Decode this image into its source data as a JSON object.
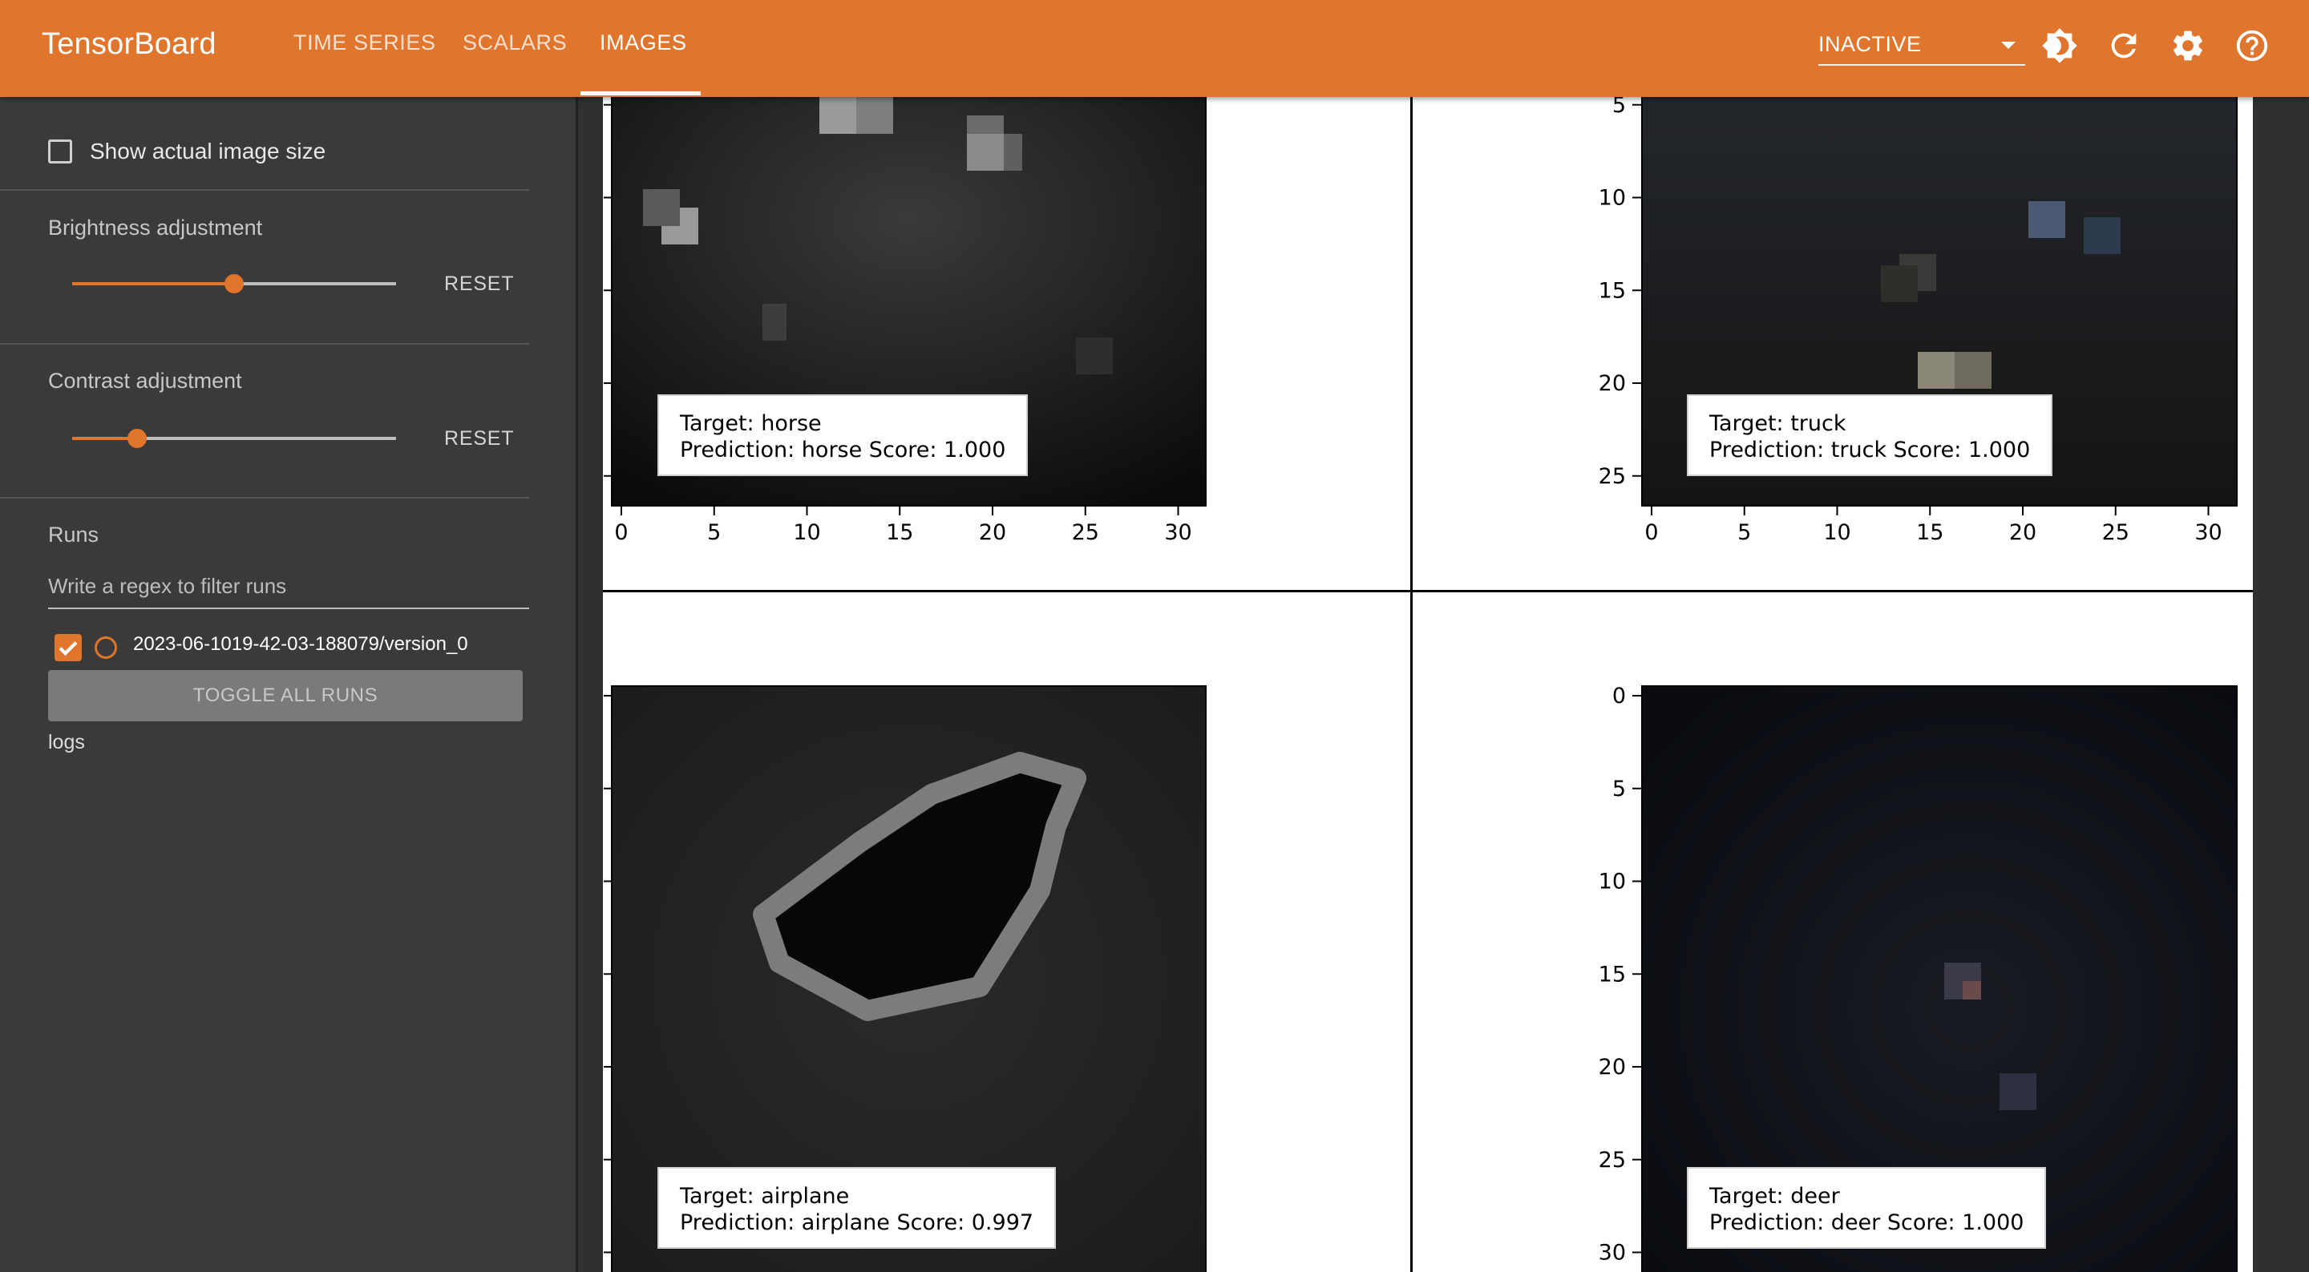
{
  "app": {
    "brand": "TensorBoard"
  },
  "nav": {
    "tabs": [
      {
        "label": "TIME SERIES"
      },
      {
        "label": "SCALARS"
      },
      {
        "label": "IMAGES"
      }
    ],
    "active_tab": "IMAGES",
    "status_select": {
      "value": "INACTIVE"
    },
    "icons": [
      "brightness-icon",
      "refresh-icon",
      "settings-icon",
      "help-icon"
    ]
  },
  "sidebar": {
    "show_actual_size_label": "Show actual image size",
    "show_actual_size_checked": false,
    "brightness": {
      "label": "Brightness adjustment",
      "reset_label": "RESET",
      "level": 0.5
    },
    "contrast": {
      "label": "Contrast adjustment",
      "reset_label": "RESET",
      "level": 0.2
    },
    "runs": {
      "heading": "Runs",
      "filter_placeholder": "Write a regex to filter runs",
      "items": [
        {
          "name": "2023-06-1019-42-03-188079/version_0",
          "checked": true
        }
      ],
      "toggle_all_label": "TOGGLE ALL RUNS",
      "group_label": "logs"
    }
  },
  "figure": {
    "ticks": [
      "0",
      "5",
      "10",
      "15",
      "20",
      "25",
      "30"
    ],
    "panels": [
      {
        "target": "Target: horse",
        "prediction": "Prediction: horse Score: 1.000"
      },
      {
        "target": "Target: truck",
        "prediction": "Prediction: truck Score: 1.000"
      },
      {
        "target": "Target: airplane",
        "prediction": "Prediction: airplane Score: 0.997"
      },
      {
        "target": "Target: deer",
        "prediction": "Prediction: deer Score: 1.000"
      }
    ]
  },
  "colors": {
    "accent": "#e0762d",
    "sidebar_bg": "#3a3a3a",
    "header_text": "#ffffff"
  }
}
